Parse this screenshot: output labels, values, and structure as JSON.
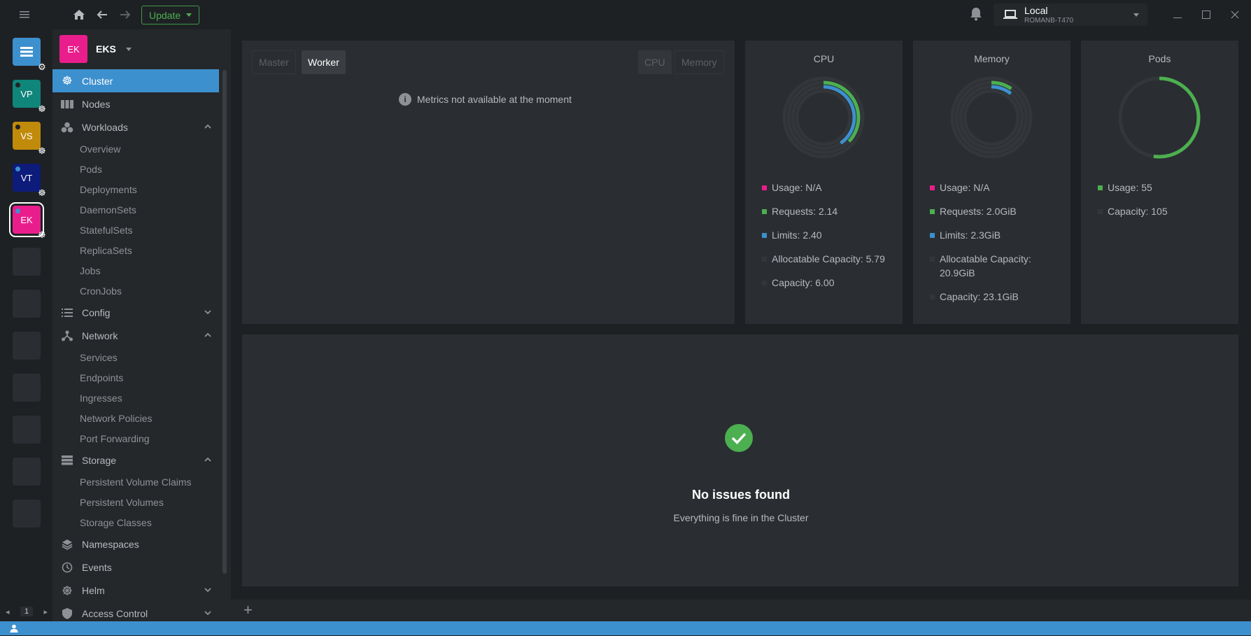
{
  "titlebar": {
    "update_label": "Update",
    "local_name": "Local",
    "local_host": "ROMANB-T470"
  },
  "hotbar": {
    "items": [
      {
        "label": "",
        "color": "#3d90ce"
      },
      {
        "label": "VP",
        "color": "#10857a"
      },
      {
        "label": "VS",
        "color": "#c08a0b"
      },
      {
        "label": "VT",
        "color": "#0d1b7a"
      },
      {
        "label": "EK",
        "color": "#e91e8c"
      }
    ],
    "page": "1"
  },
  "cluster": {
    "avatar": "EK",
    "name": "EKS"
  },
  "nav": {
    "cluster": "Cluster",
    "nodes": "Nodes",
    "workloads": "Workloads",
    "workloads_sub": [
      "Overview",
      "Pods",
      "Deployments",
      "DaemonSets",
      "StatefulSets",
      "ReplicaSets",
      "Jobs",
      "CronJobs"
    ],
    "config": "Config",
    "network": "Network",
    "network_sub": [
      "Services",
      "Endpoints",
      "Ingresses",
      "Network Policies",
      "Port Forwarding"
    ],
    "storage": "Storage",
    "storage_sub": [
      "Persistent Volume Claims",
      "Persistent Volumes",
      "Storage Classes"
    ],
    "namespaces": "Namespaces",
    "events": "Events",
    "helm": "Helm",
    "access_control": "Access Control"
  },
  "metrics": {
    "master_tab": "Master",
    "worker_tab": "Worker",
    "cpu_tab": "CPU",
    "memory_tab": "Memory",
    "message": "Metrics not available at the moment"
  },
  "cpu": {
    "title": "CPU",
    "usage": "Usage: N/A",
    "requests": "Requests: 2.14",
    "limits": "Limits: 2.40",
    "allocatable": "Allocatable Capacity: 5.79",
    "capacity": "Capacity: 6.00"
  },
  "memory": {
    "title": "Memory",
    "usage": "Usage: N/A",
    "requests": "Requests: 2.0GiB",
    "limits": "Limits: 2.3GiB",
    "allocatable": "Allocatable Capacity: 20.9GiB",
    "capacity": "Capacity: 23.1GiB"
  },
  "pods": {
    "title": "Pods",
    "usage": "Usage: 55",
    "capacity": "Capacity: 105"
  },
  "issues": {
    "title": "No issues found",
    "subtitle": "Everything is fine in the Cluster"
  },
  "colors": {
    "accent": "#3d90ce",
    "usage": "#e91e8c",
    "requests": "#4caf50",
    "limits": "#3d90ce",
    "capacity": "#33363a"
  }
}
